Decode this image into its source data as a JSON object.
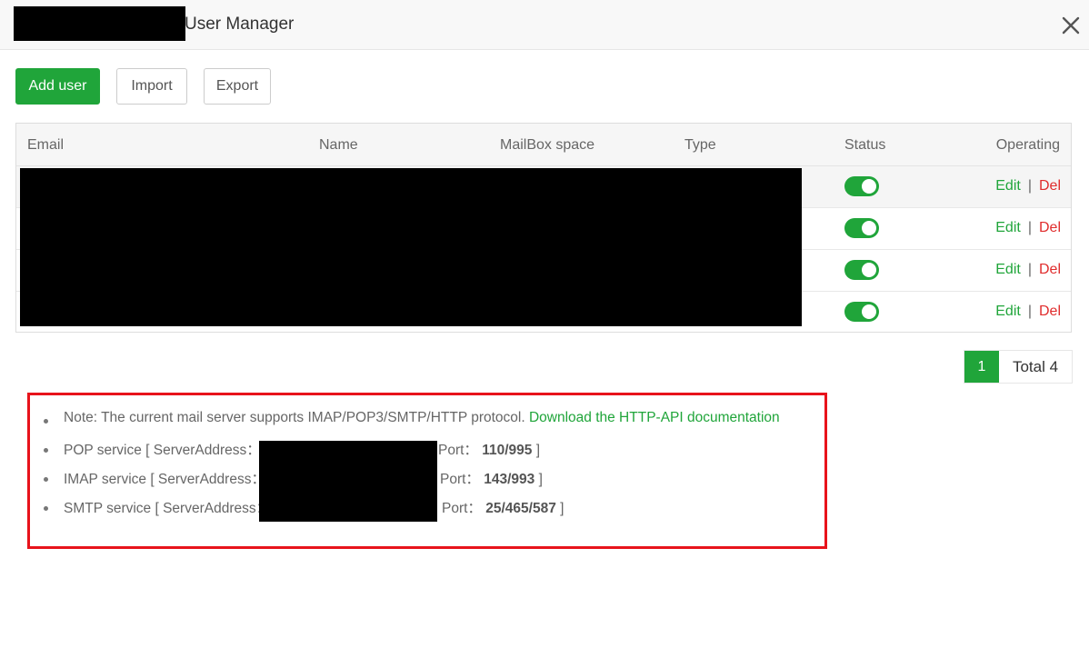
{
  "title": {
    "text": "User Manager"
  },
  "toolbar": {
    "add_label": "Add user",
    "import_label": "Import",
    "export_label": "Export"
  },
  "table": {
    "columns": [
      "Email",
      "Name",
      "MailBox space",
      "Type",
      "Status",
      "Operating"
    ],
    "rows": [
      {
        "status_on": true,
        "edit": "Edit",
        "sep": "|",
        "del": "Del"
      },
      {
        "status_on": true,
        "edit": "Edit",
        "sep": "|",
        "del": "Del"
      },
      {
        "status_on": true,
        "edit": "Edit",
        "sep": "|",
        "del": "Del"
      },
      {
        "status_on": true,
        "edit": "Edit",
        "sep": "|",
        "del": "Del"
      }
    ]
  },
  "pagination": {
    "current": "1",
    "total": "Total 4"
  },
  "notes": {
    "note_text": "Note: The current mail server supports IMAP/POP3/SMTP/HTTP protocol. ",
    "note_link": "Download the HTTP-API documentation",
    "pop": {
      "label": "POP service [ ServerAddress：",
      "port_label": "Port：",
      "port": "110/995",
      "end": " ]"
    },
    "imap": {
      "label": "IMAP service [ ServerAddress：",
      "port_label": "Port：",
      "port": "143/993",
      "end": " ]"
    },
    "smtp": {
      "label": "SMTP service [ ServerAddress：",
      "port_label": "Port：",
      "port": "25/465/587",
      "end": " ]"
    }
  },
  "colors": {
    "accent": "#20a53a",
    "danger": "#e02d2d",
    "highlight_border": "#e8131b"
  }
}
